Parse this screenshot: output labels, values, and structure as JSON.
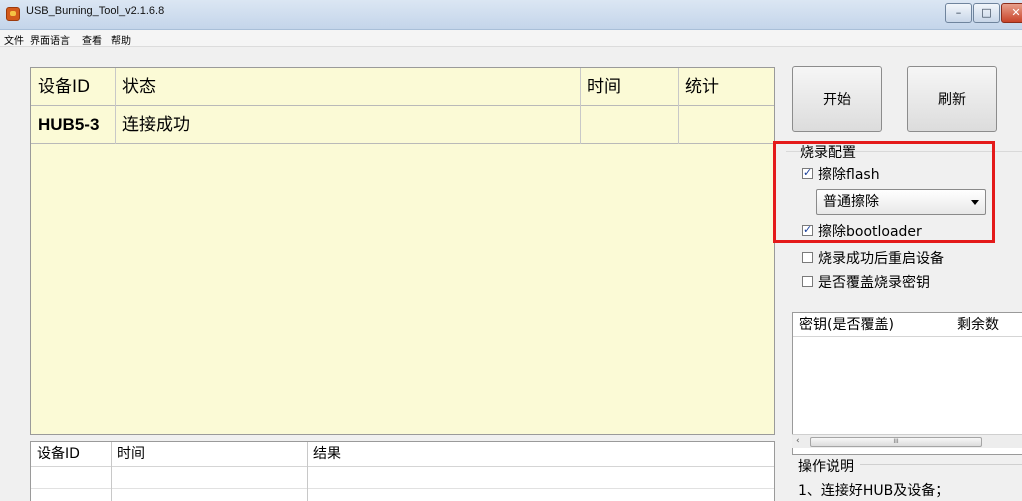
{
  "window": {
    "title": "USB_Burning_Tool_v2.1.6.8",
    "min": "–",
    "max": "□",
    "close": "✕"
  },
  "menu": [
    "文件",
    "界面语言",
    "查看",
    "帮助"
  ],
  "device_table": {
    "columns": [
      "设备ID",
      "状态",
      "时间",
      "统计"
    ],
    "rows": [
      {
        "id": "HUB5-3",
        "status": "连接成功",
        "time": "",
        "stats": ""
      }
    ]
  },
  "result_table": {
    "columns": [
      "设备ID",
      "时间",
      "结果"
    ]
  },
  "buttons": {
    "start": "开始",
    "refresh": "刷新"
  },
  "config": {
    "title": "烧录配置",
    "erase_flash": {
      "label": "擦除flash",
      "checked": true
    },
    "erase_mode": "普通擦除",
    "erase_bootloader": {
      "label": "擦除bootloader",
      "checked": true
    },
    "reboot_after": {
      "label": "烧录成功后重启设备",
      "checked": false
    },
    "overwrite_key": {
      "label": "是否覆盖烧录密钥",
      "checked": false
    }
  },
  "key_list": {
    "columns": [
      "密钥(是否覆盖)",
      "剩余数"
    ],
    "scroll_glyph": "‹",
    "thumb_glyph": "III"
  },
  "instructions": {
    "title": "操作说明",
    "line1": "1、连接好HUB及设备；"
  }
}
